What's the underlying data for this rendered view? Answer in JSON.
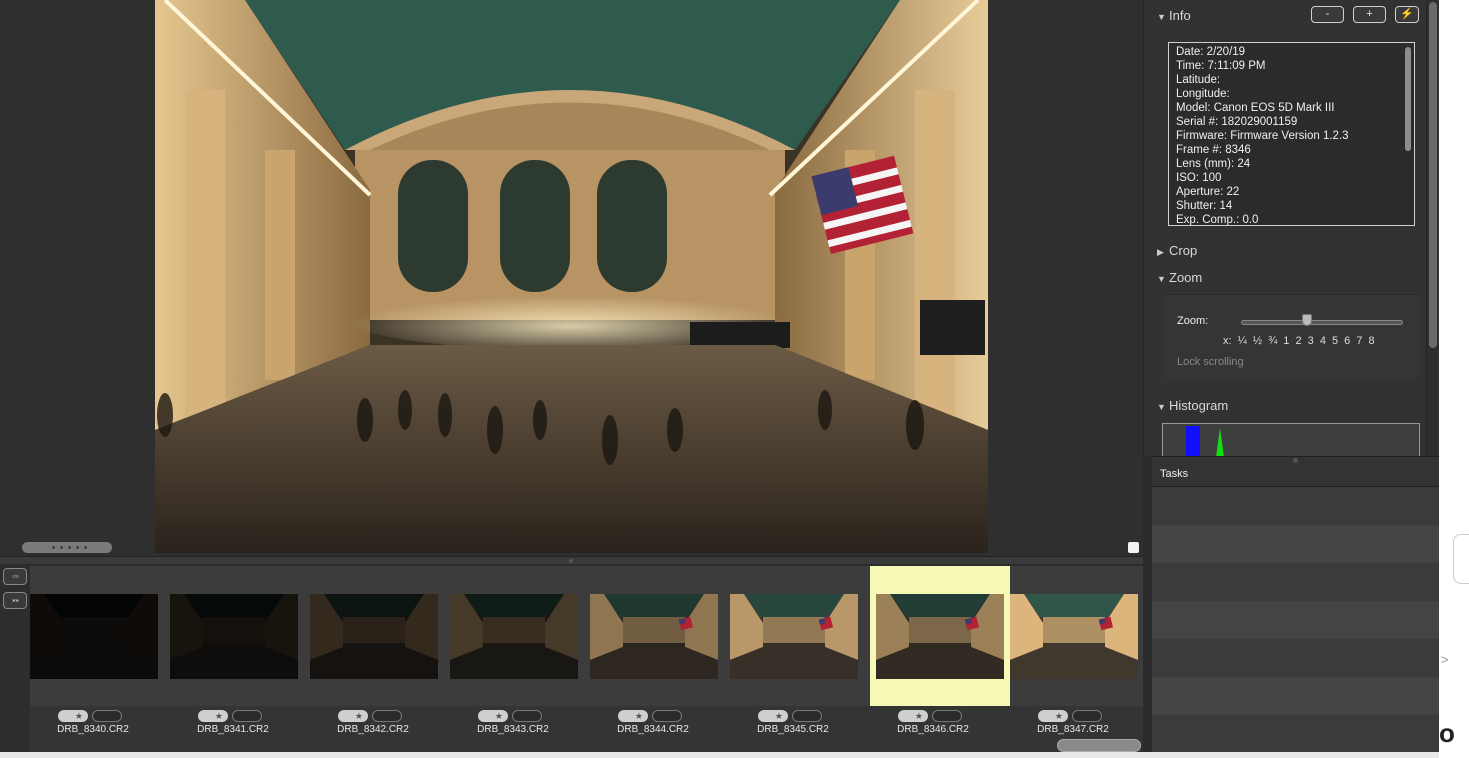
{
  "inspector": {
    "info": {
      "title": "Info",
      "minus_label": "-",
      "plus_label": "+",
      "lines": [
        "Date: 2/20/19",
        "Time: 7:11:09 PM",
        "Latitude:",
        "Longitude:",
        "Model: Canon EOS 5D Mark III",
        "Serial #: 182029001159",
        "Firmware: Firmware Version 1.2.3",
        "Frame #: 8346",
        "Lens (mm): 24",
        "ISO: 100",
        "Aperture: 22",
        "Shutter: 14",
        "Exp. Comp.: 0.0"
      ]
    },
    "crop": {
      "title": "Crop"
    },
    "zoom": {
      "title": "Zoom",
      "label": "Zoom:",
      "ticks": "x:  ¼  ½  ¾  1  2  3  4  5  6  7  8",
      "lock_label": "Lock scrolling",
      "slider_value_fraction": 0.41
    },
    "histogram": {
      "title": "Histogram"
    }
  },
  "tasks": {
    "title": "Tasks"
  },
  "filmstrip": {
    "selected_index": 6,
    "items": [
      {
        "name": "DRB_8340.CR2",
        "brightness": 0.06
      },
      {
        "name": "DRB_8341.CR2",
        "brightness": 0.1
      },
      {
        "name": "DRB_8342.CR2",
        "brightness": 0.22
      },
      {
        "name": "DRB_8343.CR2",
        "brightness": 0.3
      },
      {
        "name": "DRB_8344.CR2",
        "brightness": 0.62
      },
      {
        "name": "DRB_8345.CR2",
        "brightness": 0.8
      },
      {
        "name": "DRB_8346.CR2",
        "brightness": 0.68
      },
      {
        "name": "DRB_8347.CR2",
        "brightness": 0.95
      }
    ]
  },
  "colors": {
    "selected_thumb": "#f7f9b6",
    "histogram_blue": "#1010ff",
    "histogram_green": "#10e010"
  }
}
